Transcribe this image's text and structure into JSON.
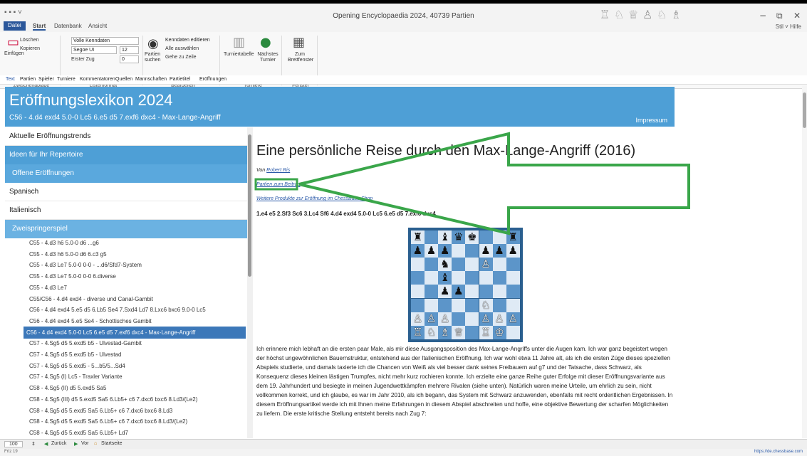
{
  "window": {
    "title": "Opening Encyclopaedia 2024,  40739 Partien",
    "piece_icons": [
      "♖",
      "♘",
      "♕",
      "♙",
      "♘",
      "♗"
    ],
    "controls": [
      "−",
      "⧉",
      "✕"
    ]
  },
  "ribbon": {
    "tabs": [
      "Datei",
      "Start",
      "Datenbank",
      "Ansicht"
    ],
    "style_label": "Stil ˅ Hilfe",
    "clipboard": {
      "paste": "Einfügen",
      "delete": "Löschen",
      "copy": "Kopieren",
      "group": "Zwischenablage"
    },
    "listformat": {
      "header_select": "Volle Kenndaten",
      "font_select": "Segoe UI",
      "size_select": "12",
      "first_move_label": "Erster Zug",
      "first_move_value": "0",
      "group": "Listenformat"
    },
    "edit": {
      "search_games": "Partien suchen",
      "edit_headers": "Kenndaten editieren",
      "select_all": "Alle auswählen",
      "goto_line": "Gehe zu Zeile",
      "group": "Bearbeiten"
    },
    "tournaments": {
      "table": "Turniertabelle",
      "next": "Nächstes Turnier",
      "group": "Turniere"
    },
    "window": {
      "to_board": "Zum Brettfenster",
      "group": "Fenster"
    }
  },
  "nav": [
    "Text",
    "Partien",
    "Spieler",
    "Turniere",
    "Kommentatoren",
    "Quellen",
    "Mannschaften",
    "Partietitel",
    "Eröffnungen"
  ],
  "header": {
    "title": "Eröffnungslexikon 2024",
    "subtitle": "C56 - 4.d4 exd4 5.0-0 Lc5 6.e5 d5 7.exf6 dxc4 - Max-Lange-Angriff",
    "imprint": "Impressum"
  },
  "sidebar": {
    "sections": [
      {
        "label": "Aktuelle Eröffnungstrends",
        "style": "plain"
      },
      {
        "label": "Ideen für Ihr Repertoire",
        "style": "blue1"
      },
      {
        "label": "Offene Eröffnungen",
        "style": "blue2"
      },
      {
        "label": "Spanisch",
        "style": "plain"
      },
      {
        "label": "Italienisch",
        "style": "plain"
      },
      {
        "label": "Zweispringerspiel",
        "style": "blue3"
      }
    ],
    "lines": [
      "C55 - 4.d3 h6 5.0-0 d6 ...g6",
      "C55 - 4.d3 h6 5.0-0 d6 6.c3 g5",
      "C55 - 4.d3 Le7 5.0-0 0-0 - ...d6/Sfd7-System",
      "C55 - 4.d3 Le7 5.0-0 0-0 6.diverse",
      "C55 - 4.d3 Le7",
      "C55/C56 - 4.d4 exd4 - diverse und Canal-Gambit",
      "C56 - 4.d4 exd4 5.e5 d5 6.Lb5 Se4 7.Sxd4 Ld7 8.Lxc6 bxc6 9.0-0 Lc5",
      "C56 - 4.d4 exd4 5.e5 Se4 - Schottisches Gambit",
      "C56 - 4.d4 exd4 5.0-0 Lc5 6.e5 d5 7.exf6 dxc4 - Max-Lange-Angriff",
      "C57 - 4.Sg5 d5 5.exd5 b5 - Ulvestad-Gambit",
      "C57 - 4.Sg5 d5 5.exd5 b5 - Ulvestad",
      "C57 - 4.Sg5 d5 5.exd5 - 5...b5/5...Sd4",
      "C57 - 4.Sg5 (I) Lc5 - Traxler Variante",
      "C58 - 4.Sg5 (II) d5 5.exd5 Sa5",
      "C58 - 4.Sg5 (III) d5 5.exd5 Sa5 6.Lb5+ c6 7.dxc6 bxc6 8.Ld3/(Le2)",
      "C58 - 4.Sg5 d5 5.exd5 Sa5 6.Lb5+ c6 7.dxc6 bxc6 8.Ld3",
      "C58 - 4.Sg5 d5 5.exd5 Sa5 6.Lb5+ c6 7.dxc6 bxc6 8.Ld3/(Le2)",
      "C58 - 4.Sg5 d5 5.exd5 Sa5 6.Lb5+ Ld7"
    ],
    "selected_index": 8
  },
  "article": {
    "title": "Eine persönliche Reise durch den Max-Lange-Angriff (2016)",
    "by_label": "Von",
    "author": "Robert Ris",
    "games_link": "Partien zum Beitrag",
    "products_link": "Weitere Produkte zur Eröffnung im ChessBase Shop",
    "moves": "1.e4 e5 2.Sf3 Sc6 3.Lc4 Sf6 4.d4 exd4 5.0-0 Lc5 6.e5 d5 7.exf6 dxc4",
    "board": [
      "r.bqk..r",
      "ppp..ppp",
      "..n..P..",
      "..b.....",
      "..pp....",
      ".....N..",
      "PPP..PPP",
      "RNBQ.RK."
    ],
    "body": "Ich erinnere mich lebhaft an die ersten paar Male, als mir diese Ausgangsposition des Max-Lange-Angriffs unter die Augen kam. Ich war ganz begeistert wegen der höchst ungewöhnlichen Bauernstruktur, entstehend aus der Italienischen Eröffnung. Ich war wohl etwa 11 Jahre alt, als ich die ersten Züge dieses speziellen Abspiels studierte, und damals taxierte ich die Chancen von Weiß als viel besser dank seines Freibauern auf g7 und der Tatsache, dass Schwarz, als Konsequenz dieses kleinen lästigen Trumpfes, nicht mehr kurz rochieren konnte. Ich erzielte eine ganze Reihe guter Erfolge mit dieser Eröffnungsvariante aus dem 19. Jahrhundert und besiegte in meinen Jugendwettkämpfen mehrere Rivalen (siehe unten). Natürlich waren meine Urteile, um ehrlich zu sein, nicht vollkommen korrekt, und ich glaube, es war im Jahr 2010, als ich begann, das System mit Schwarz anzuwenden, ebenfalls mit recht ordentlichen Ergebnissen. In diesem Eröffnungsartikel werde ich mit Ihnen meine Erfahrungen in diesem Abspiel abschreiten und hoffe, eine objektive Bewertung der scharfen Möglichkeiten zu liefern. Die erste kritische Stellung entsteht bereits nach Zug 7:"
  },
  "annotation": {
    "color": "#3aa64a"
  },
  "bottom": {
    "zoom": "100",
    "back": "Zurück",
    "forward": "Vor",
    "home": "Startseite",
    "status_left": "Frtz 19",
    "status_right": "https://de.chessbase.com"
  }
}
